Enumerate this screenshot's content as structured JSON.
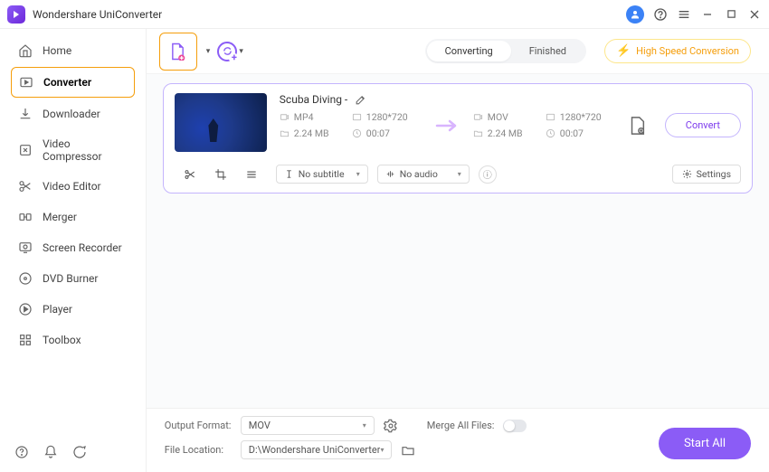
{
  "app": {
    "title": "Wondershare UniConverter"
  },
  "sidebar": {
    "items": [
      {
        "label": "Home"
      },
      {
        "label": "Converter"
      },
      {
        "label": "Downloader"
      },
      {
        "label": "Video Compressor"
      },
      {
        "label": "Video Editor"
      },
      {
        "label": "Merger"
      },
      {
        "label": "Screen Recorder"
      },
      {
        "label": "DVD Burner"
      },
      {
        "label": "Player"
      },
      {
        "label": "Toolbox"
      }
    ]
  },
  "toolbar": {
    "tabs": {
      "converting": "Converting",
      "finished": "Finished"
    },
    "high_speed": "High Speed Conversion"
  },
  "file": {
    "name": "Scuba Diving -",
    "src": {
      "format": "MP4",
      "resolution": "1280*720",
      "size": "2.24 MB",
      "duration": "00:07"
    },
    "dst": {
      "format": "MOV",
      "resolution": "1280*720",
      "size": "2.24 MB",
      "duration": "00:07"
    },
    "subtitle": "No subtitle",
    "audio": "No audio",
    "settings_label": "Settings",
    "convert_label": "Convert"
  },
  "footer": {
    "output_format_label": "Output Format:",
    "output_format_value": "MOV",
    "file_location_label": "File Location:",
    "file_location_value": "D:\\Wondershare UniConverter",
    "merge_label": "Merge All Files:",
    "start_all": "Start All"
  }
}
